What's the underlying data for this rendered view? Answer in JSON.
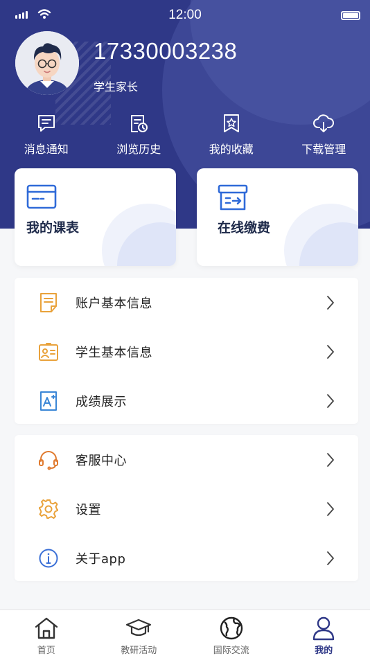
{
  "status_bar": {
    "time": "12:00"
  },
  "profile": {
    "phone": "17330003238",
    "role": "学生家长"
  },
  "quick_actions": [
    {
      "label": "消息通知",
      "icon": "message-icon"
    },
    {
      "label": "浏览历史",
      "icon": "history-icon"
    },
    {
      "label": "我的收藏",
      "icon": "favorites-icon"
    },
    {
      "label": "下载管理",
      "icon": "download-cloud-icon"
    }
  ],
  "cards": {
    "schedule": {
      "label": "我的课表",
      "icon": "schedule-card-icon"
    },
    "payment": {
      "label": "在线缴费",
      "icon": "payment-box-icon"
    }
  },
  "menu_group_1": [
    {
      "label": "账户基本信息",
      "icon": "document-icon"
    },
    {
      "label": "学生基本信息",
      "icon": "id-card-icon"
    },
    {
      "label": "成绩展示",
      "icon": "grade-icon"
    }
  ],
  "menu_group_2": [
    {
      "label": "客服中心",
      "icon": "headset-icon"
    },
    {
      "label": "设置",
      "icon": "gear-icon"
    },
    {
      "label": "关于app",
      "icon": "info-icon"
    }
  ],
  "tabs": [
    {
      "label": "首页",
      "icon": "home-icon"
    },
    {
      "label": "教研活动",
      "icon": "graduation-cap-icon"
    },
    {
      "label": "国际交流",
      "icon": "globe-icon"
    },
    {
      "label": "我的",
      "icon": "user-icon",
      "active": true
    }
  ],
  "colors": {
    "header_bg": "#2f3887",
    "accent_blue": "#3a6fd6",
    "orange": "#e9a23b",
    "active_tab": "#2f3887"
  }
}
